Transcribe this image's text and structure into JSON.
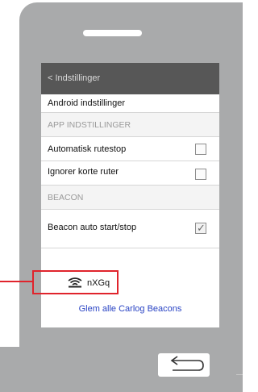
{
  "nav": {
    "back_label": "< Indstillinger"
  },
  "rows": {
    "android_settings": "Android indstillinger",
    "app_settings_header": "APP INDSTILLINGER",
    "auto_route_stop": "Automatisk rutestop",
    "ignore_short_routes": "Ignorer korte ruter",
    "beacon_header": "BEACON",
    "beacon_auto_start_stop": "Beacon auto start/stop"
  },
  "checkboxes": {
    "auto_route_stop_checked": false,
    "ignore_short_routes_checked": false,
    "beacon_auto_start_stop_checked": true
  },
  "beacon": {
    "name": "nXGq",
    "icon": "wifi-signal-icon"
  },
  "forget_link": "Glem alle Carlog Beacons",
  "colors": {
    "frame": "#a9aaab",
    "nav_bar": "#575757",
    "link": "#2a44c4",
    "highlight": "#e0242c"
  },
  "icons": {
    "back_button": "return-arrow-icon",
    "checkmark": "checkmark-icon"
  }
}
